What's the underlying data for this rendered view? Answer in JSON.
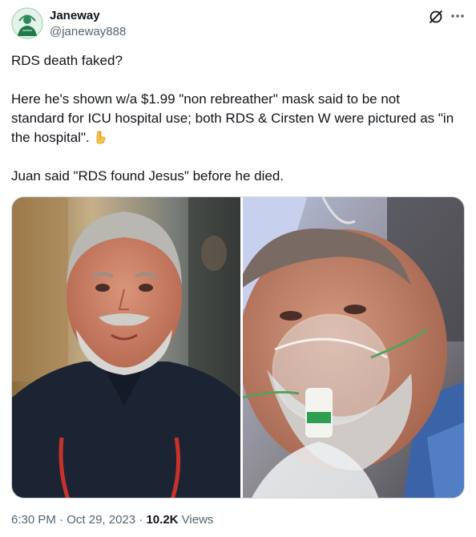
{
  "author": {
    "name": "Janeway",
    "handle": "@janeway888",
    "avatar_icon": "avatar-illustration"
  },
  "header_icons": {
    "grok": "grok-slash-icon",
    "more": "more-icon"
  },
  "tweet": {
    "lines": [
      "RDS death faked?",
      "Here he's shown w/a $1.99 \"non rebreather\" mask said to be not",
      "standard for ICU hospital use; both RDS & Cirsten W were pictured as \"in",
      "the hospital\".",
      "Juan said \"RDS found Jesus\" before he died."
    ],
    "emoji": "backhand-index-pointing-down"
  },
  "media": {
    "images": [
      "left-photo",
      "right-photo"
    ]
  },
  "meta": {
    "time": "6:30 PM",
    "sep1": " · ",
    "date": "Oct 29, 2023",
    "sep2": " · ",
    "views_count": "10.2K",
    "views_label": " Views"
  },
  "colors": {
    "text": "#0f1419",
    "secondary": "#536471",
    "border": "#cfd9de"
  }
}
